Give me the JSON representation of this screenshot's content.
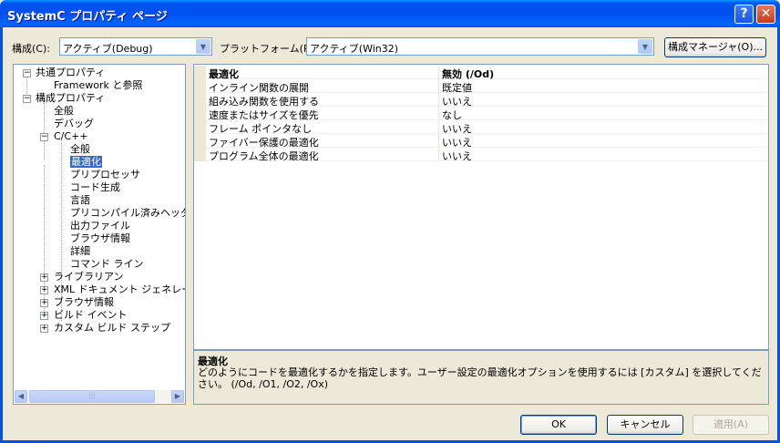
{
  "window": {
    "title": "SystemC プロパティ ページ",
    "help_btn": "?",
    "close_btn": "✕"
  },
  "toolbar": {
    "config_label": "構成(C):",
    "config_value": "アクティブ(Debug)",
    "platform_label": "プラットフォーム(P):",
    "platform_value": "アクティブ(Win32)",
    "manager_button": "構成マネージャ(O)..."
  },
  "tree": {
    "common": "共通プロパティ",
    "framework": "Framework と参照",
    "config": "構成プロパティ",
    "general": "全般",
    "debug": "デバッグ",
    "cpp": "C/C++",
    "cpp_general": "全般",
    "optimization": "最適化",
    "preprocessor": "プリプロセッサ",
    "codegen": "コード生成",
    "language": "言語",
    "pch": "プリコンパイル済みヘッダー",
    "output": "出力ファイル",
    "browse": "ブラウザ情報",
    "advanced": "詳細",
    "cmdline": "コマンド ライン",
    "librarian": "ライブラリアン",
    "xmldoc": "XML ドキュメント ジェネレータ",
    "browse2": "ブラウザ情報",
    "build_events": "ビルド イベント",
    "custom_build": "カスタム ビルド ステップ",
    "scroll_grip": "|||"
  },
  "grid": {
    "rows": [
      {
        "name": "最適化",
        "value": "無効 (/Od)"
      },
      {
        "name": "インライン関数の展開",
        "value": "既定値"
      },
      {
        "name": "組み込み関数を使用する",
        "value": "いいえ"
      },
      {
        "name": "速度またはサイズを優先",
        "value": "なし"
      },
      {
        "name": "フレーム ポインタなし",
        "value": "いいえ"
      },
      {
        "name": "ファイバー保護の最適化",
        "value": "いいえ"
      },
      {
        "name": "プログラム全体の最適化",
        "value": "いいえ"
      }
    ]
  },
  "description": {
    "title": "最適化",
    "text": "どのようにコードを最適化するかを指定します。ユーザー設定の最適化オプションを使用するには [カスタム] を選択してください。 (/Od, /O1, /O2, /Ox)"
  },
  "footer": {
    "ok": "OK",
    "cancel": "キャンセル",
    "apply": "適用(A)"
  },
  "colors": {
    "title_bar": "#0054e3",
    "selection": "#316ac5",
    "dialog_bg": "#ece9d8"
  }
}
